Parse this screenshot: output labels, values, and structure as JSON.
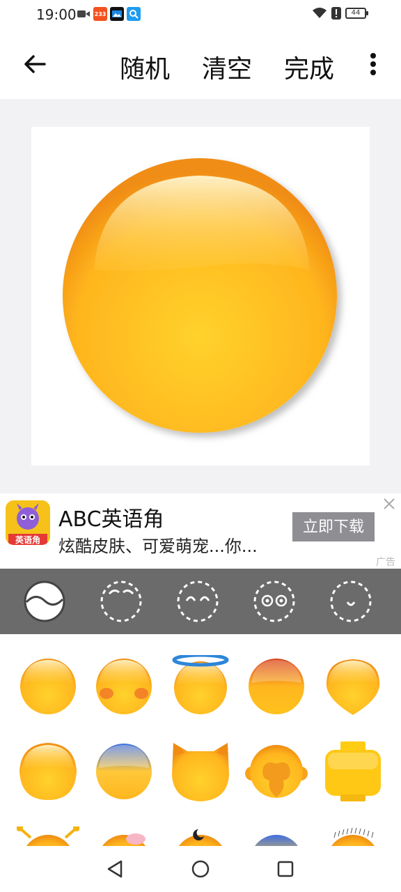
{
  "status_bar": {
    "time": "19:00",
    "badge_233": "233",
    "battery": "44",
    "icons": [
      "video-icon",
      "app-233-icon",
      "image-icon",
      "search-app-icon",
      "wifi-icon",
      "alert-icon",
      "battery-icon"
    ]
  },
  "toolbar": {
    "back_icon": "arrow-left-icon",
    "random_label": "随机",
    "clear_label": "清空",
    "done_label": "完成",
    "more_icon": "more-vertical-icon"
  },
  "ad": {
    "icon_text": "英语角",
    "title": "ABC英语角",
    "subtitle": "炫酷皮肤、可爱萌宠...你...",
    "button_label": "立即下载",
    "tag": "广告"
  },
  "categories": [
    {
      "name": "face-shape",
      "selected": true
    },
    {
      "name": "eyebrows",
      "selected": false
    },
    {
      "name": "eyes",
      "selected": false
    },
    {
      "name": "glasses-eyes",
      "selected": false
    },
    {
      "name": "mouth",
      "selected": false
    }
  ],
  "colors": {
    "face_light": "#ffd84a",
    "face_dark": "#f7a21b",
    "category_bg": "#6b6b6b",
    "canvas_bg": "#f2f2f4"
  }
}
